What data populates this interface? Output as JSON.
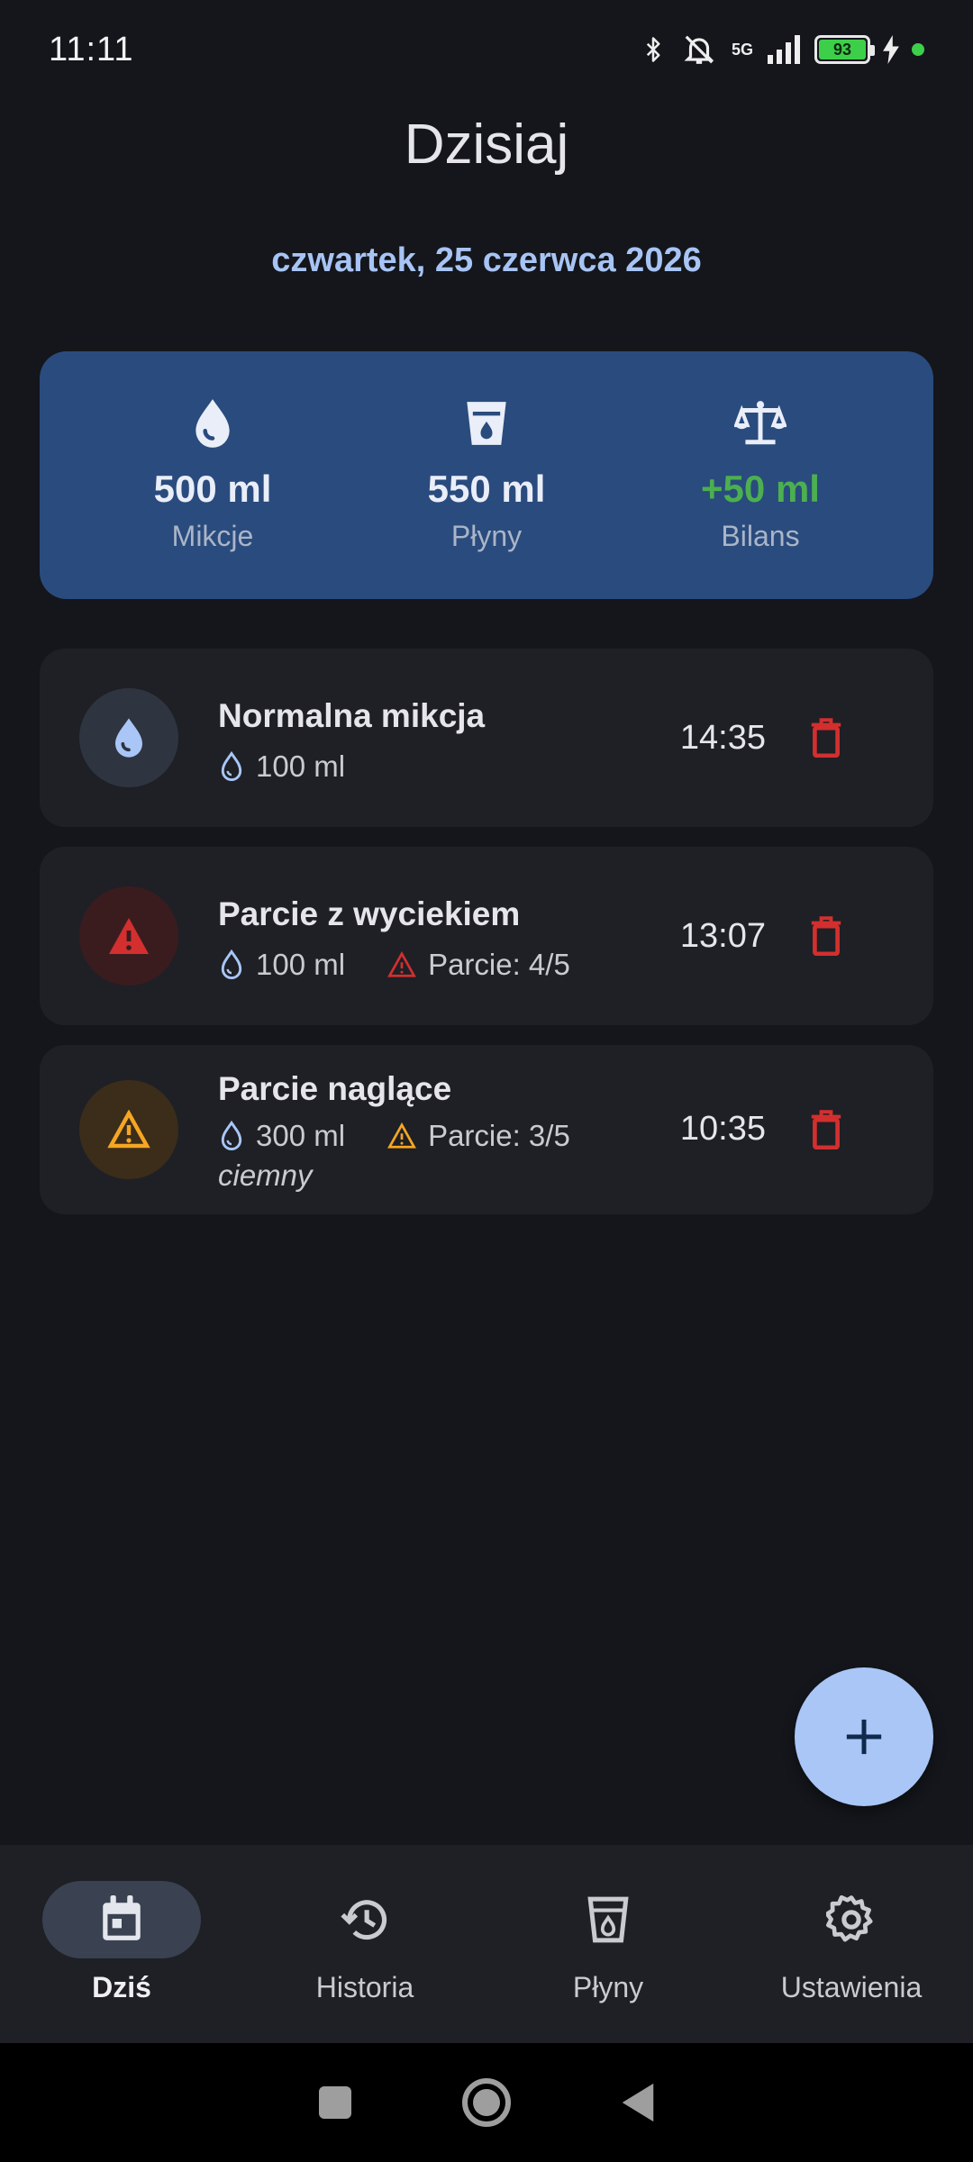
{
  "status_bar": {
    "time": "11:11",
    "network": "5G",
    "battery": "93"
  },
  "header": {
    "title": "Dzisiaj",
    "date": "czwartek, 25 czerwca 2026"
  },
  "summary": {
    "items": [
      {
        "icon": "water-drop-icon",
        "value": "500 ml",
        "label": "Mikcje"
      },
      {
        "icon": "cup-icon",
        "value": "550 ml",
        "label": "Płyny"
      },
      {
        "icon": "scale-balance-icon",
        "value": "+50 ml",
        "label": "Bilans"
      }
    ]
  },
  "entries": [
    {
      "title": "Normalna mikcja",
      "volume": "100 ml",
      "time": "14:35",
      "type": "normal"
    },
    {
      "title": "Parcie z wyciekiem",
      "volume": "100 ml",
      "urgency": "Parcie: 4/5",
      "time": "13:07",
      "type": "leak"
    },
    {
      "title": "Parcie naglące",
      "volume": "300 ml",
      "urgency": "Parcie: 3/5",
      "note": "ciemny",
      "time": "10:35",
      "type": "urgent"
    }
  ],
  "nav": {
    "items": [
      {
        "label": "Dziś",
        "icon": "calendar-icon",
        "active": true
      },
      {
        "label": "Historia",
        "icon": "history-icon"
      },
      {
        "label": "Płyny",
        "icon": "cup-icon"
      },
      {
        "label": "Ustawienia",
        "icon": "gear-icon"
      }
    ]
  },
  "colors": {
    "background": "#14161b",
    "summary_card": "#2a4b7d",
    "accent": "#a7c4f4",
    "positive": "#4caf50",
    "danger": "#d32f2f",
    "warning": "#f5a623"
  }
}
